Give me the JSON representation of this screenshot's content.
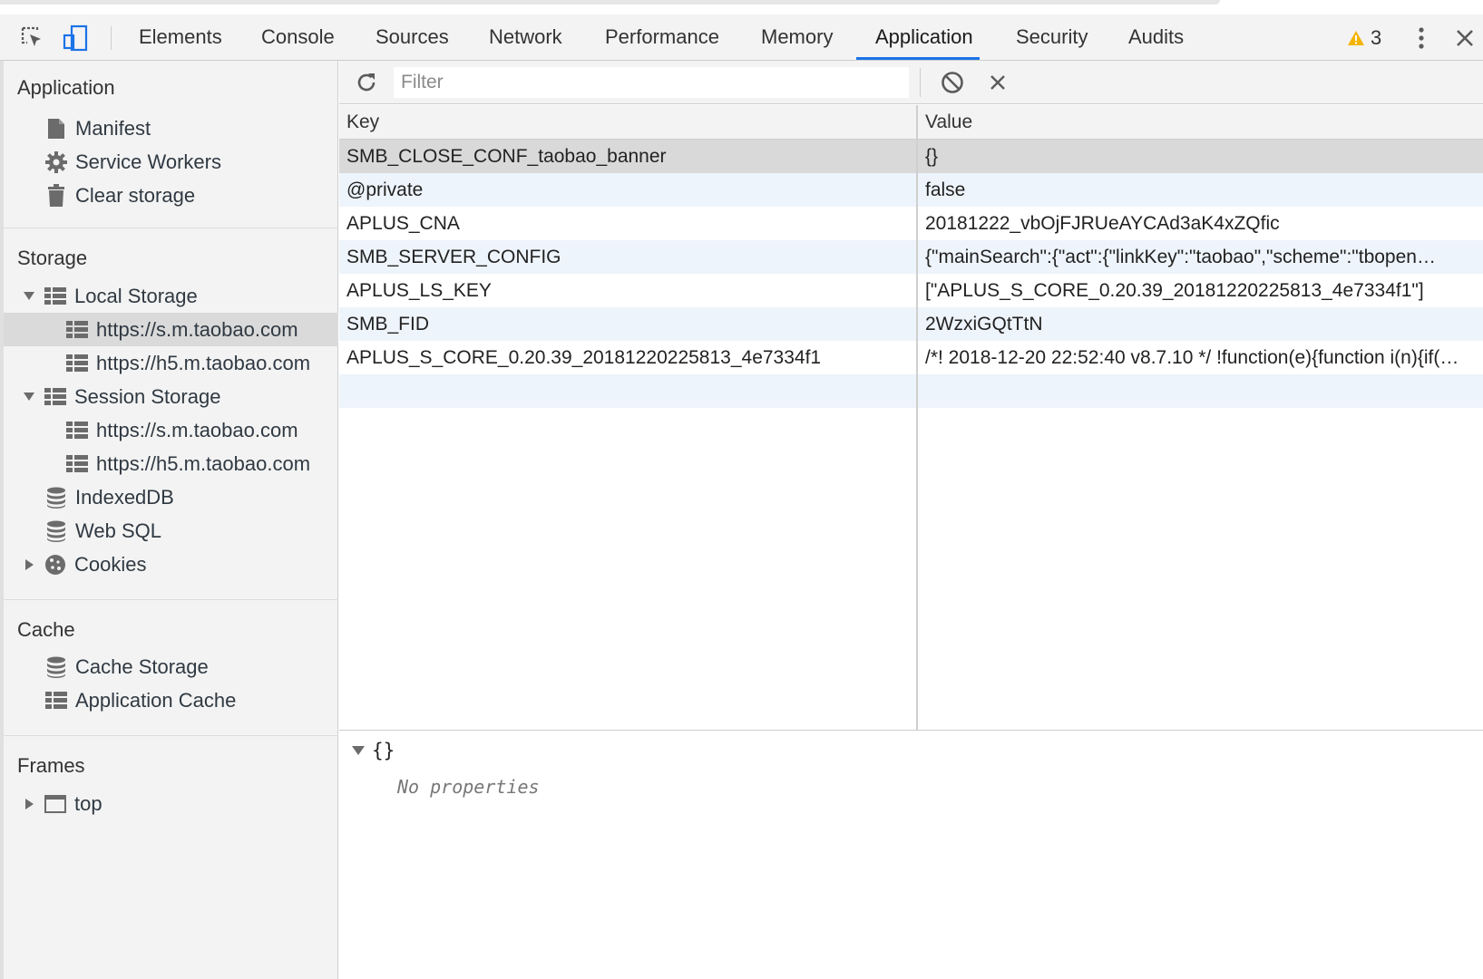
{
  "tabs": [
    {
      "label": "Elements"
    },
    {
      "label": "Console"
    },
    {
      "label": "Sources"
    },
    {
      "label": "Network"
    },
    {
      "label": "Performance"
    },
    {
      "label": "Memory"
    },
    {
      "label": "Application"
    },
    {
      "label": "Security"
    },
    {
      "label": "Audits"
    }
  ],
  "active_tab": "Application",
  "warnings_count": "3",
  "colors": {
    "accent": "#1a73e8",
    "warning": "#f4b400",
    "selected_row": "#d9d9d9",
    "alt_row": "#eef4fb"
  },
  "sidebar": {
    "application_header": "Application",
    "application_items": [
      {
        "label": "Manifest",
        "icon": "file-icon"
      },
      {
        "label": "Service Workers",
        "icon": "gear-icon"
      },
      {
        "label": "Clear storage",
        "icon": "trash-icon"
      }
    ],
    "storage_header": "Storage",
    "local_storage": {
      "label": "Local Storage",
      "items": [
        "https://s.m.taobao.com",
        "https://h5.m.taobao.com"
      ]
    },
    "session_storage": {
      "label": "Session Storage",
      "items": [
        "https://s.m.taobao.com",
        "https://h5.m.taobao.com"
      ]
    },
    "indexeddb": "IndexedDB",
    "websql": "Web SQL",
    "cookies": "Cookies",
    "cache_header": "Cache",
    "cache_items": [
      {
        "label": "Cache Storage",
        "icon": "database-icon"
      },
      {
        "label": "Application Cache",
        "icon": "grid-icon"
      }
    ],
    "frames_header": "Frames",
    "frames_top": "top"
  },
  "toolbar": {
    "filter_placeholder": "Filter"
  },
  "table": {
    "headers": {
      "key": "Key",
      "value": "Value"
    },
    "rows": [
      {
        "key": "SMB_CLOSE_CONF_taobao_banner",
        "value": "{}"
      },
      {
        "key": "@private",
        "value": "false"
      },
      {
        "key": "APLUS_CNA",
        "value": "20181222_vbOjFJRUeAYCAd3aK4xZQfic"
      },
      {
        "key": "SMB_SERVER_CONFIG",
        "value": "{\"mainSearch\":{\"act\":{\"linkKey\":\"taobao\",\"scheme\":\"tbopen…"
      },
      {
        "key": "APLUS_LS_KEY",
        "value": "[\"APLUS_S_CORE_0.20.39_20181220225813_4e7334f1\"]"
      },
      {
        "key": "SMB_FID",
        "value": "2WzxiGQtTtN"
      },
      {
        "key": "APLUS_S_CORE_0.20.39_20181220225813_4e7334f1",
        "value": "/*! 2018-12-20 22:52:40 v8.7.10 */ !function(e){function i(n){if(…"
      }
    ]
  },
  "preview": {
    "object": "{}",
    "note": "No properties"
  }
}
